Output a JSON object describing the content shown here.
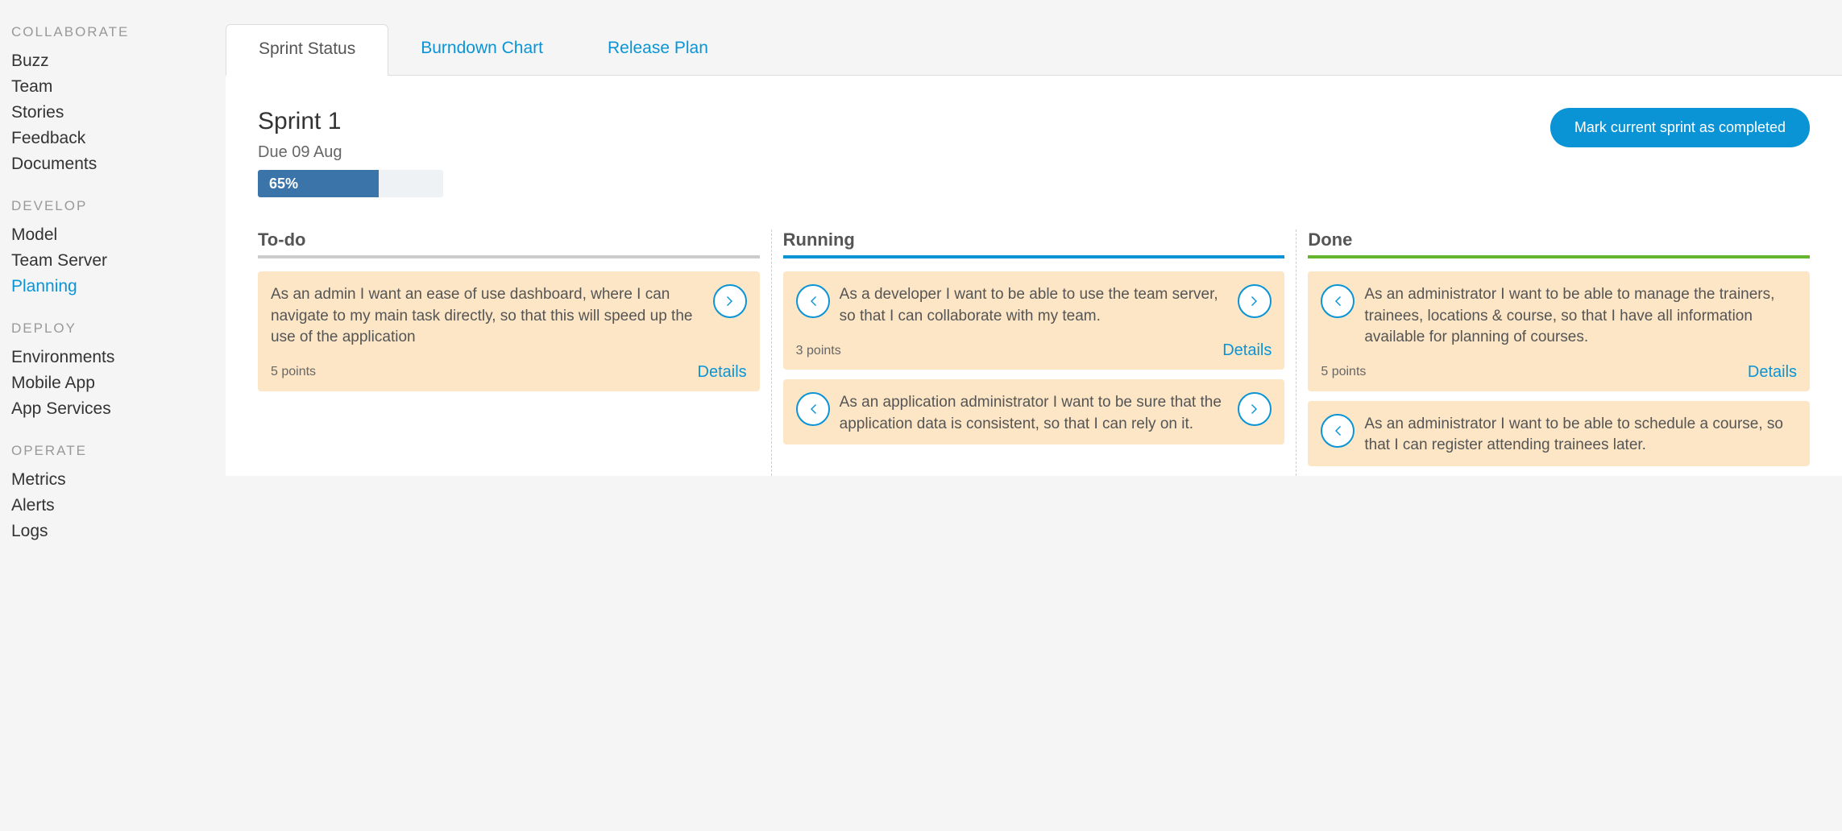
{
  "sidebar": {
    "sections": [
      {
        "title": "COLLABORATE",
        "items": [
          {
            "label": "Buzz",
            "active": false
          },
          {
            "label": "Team",
            "active": false
          },
          {
            "label": "Stories",
            "active": false
          },
          {
            "label": "Feedback",
            "active": false
          },
          {
            "label": "Documents",
            "active": false
          }
        ]
      },
      {
        "title": "DEVELOP",
        "items": [
          {
            "label": "Model",
            "active": false
          },
          {
            "label": "Team Server",
            "active": false
          },
          {
            "label": "Planning",
            "active": true
          }
        ]
      },
      {
        "title": "DEPLOY",
        "items": [
          {
            "label": "Environments",
            "active": false
          },
          {
            "label": "Mobile App",
            "active": false
          },
          {
            "label": "App Services",
            "active": false
          }
        ]
      },
      {
        "title": "OPERATE",
        "items": [
          {
            "label": "Metrics",
            "active": false
          },
          {
            "label": "Alerts",
            "active": false
          },
          {
            "label": "Logs",
            "active": false
          }
        ]
      }
    ]
  },
  "tabs": [
    {
      "label": "Sprint Status",
      "active": true
    },
    {
      "label": "Burndown Chart",
      "active": false
    },
    {
      "label": "Release Plan",
      "active": false
    }
  ],
  "sprint": {
    "title": "Sprint 1",
    "due": "Due 09 Aug",
    "progress_pct": 65,
    "progress_label": "65%",
    "complete_btn": "Mark current sprint as completed"
  },
  "board": {
    "details_label": "Details",
    "columns": [
      {
        "title": "To-do",
        "cls": "col-todo",
        "cards": [
          {
            "text": "As an admin I want an ease of use dashboard, where I can navigate to my main task directly, so that this will speed up the use of the application",
            "points": "5 points",
            "left": false,
            "right": true,
            "footer": true
          }
        ]
      },
      {
        "title": "Running",
        "cls": "col-running",
        "cards": [
          {
            "text": "As a developer I want to be able to use the team server, so that I can collaborate with my team.",
            "points": "3 points",
            "left": true,
            "right": true,
            "footer": true
          },
          {
            "text": "As an application administrator I want to be sure that the application data is consistent, so that I can rely on it.",
            "points": "",
            "left": true,
            "right": true,
            "footer": false
          }
        ]
      },
      {
        "title": "Done",
        "cls": "col-done",
        "cards": [
          {
            "text": "As an administrator I want to be able to manage the trainers, trainees, locations & course, so that I have all information available for planning of courses.",
            "points": "5 points",
            "left": true,
            "right": false,
            "footer": true
          },
          {
            "text": "As an administrator I want to be able to schedule a course, so that I can register attending trainees later.",
            "points": "",
            "left": true,
            "right": false,
            "footer": false
          }
        ]
      }
    ]
  }
}
